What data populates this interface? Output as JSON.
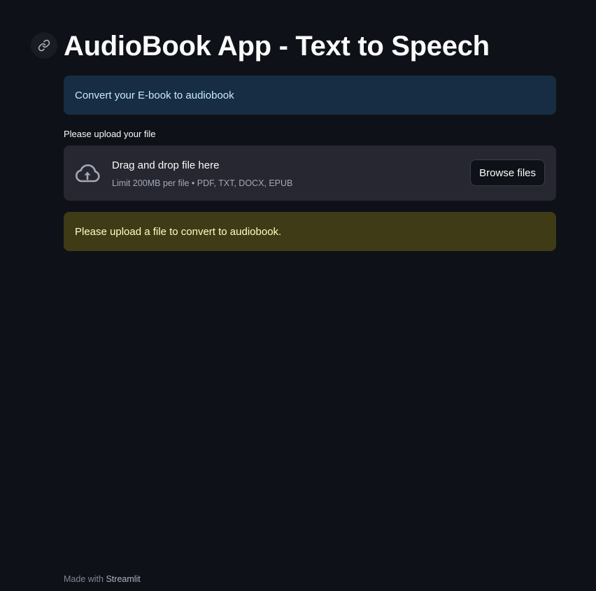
{
  "header": {
    "title": "AudioBook App - Text to Speech",
    "anchor_icon": "link-icon"
  },
  "info": {
    "message": "Convert your E-book to audiobook"
  },
  "uploader": {
    "label": "Please upload your file",
    "drop_title": "Drag and drop file here",
    "limit_hint": "Limit 200MB per file • PDF, TXT, DOCX, EPUB",
    "browse_label": "Browse files",
    "icon": "cloud-upload-icon"
  },
  "warning": {
    "message": "Please upload a file to convert to audiobook."
  },
  "footer": {
    "prefix": "Made with",
    "link": "Streamlit"
  },
  "colors": {
    "background": "#0e1117",
    "info_bg": "#172d43",
    "info_text": "#c7ebff",
    "dropzone_bg": "#262730",
    "warning_bg": "#3e3b16",
    "warning_text": "#ffffc2"
  }
}
